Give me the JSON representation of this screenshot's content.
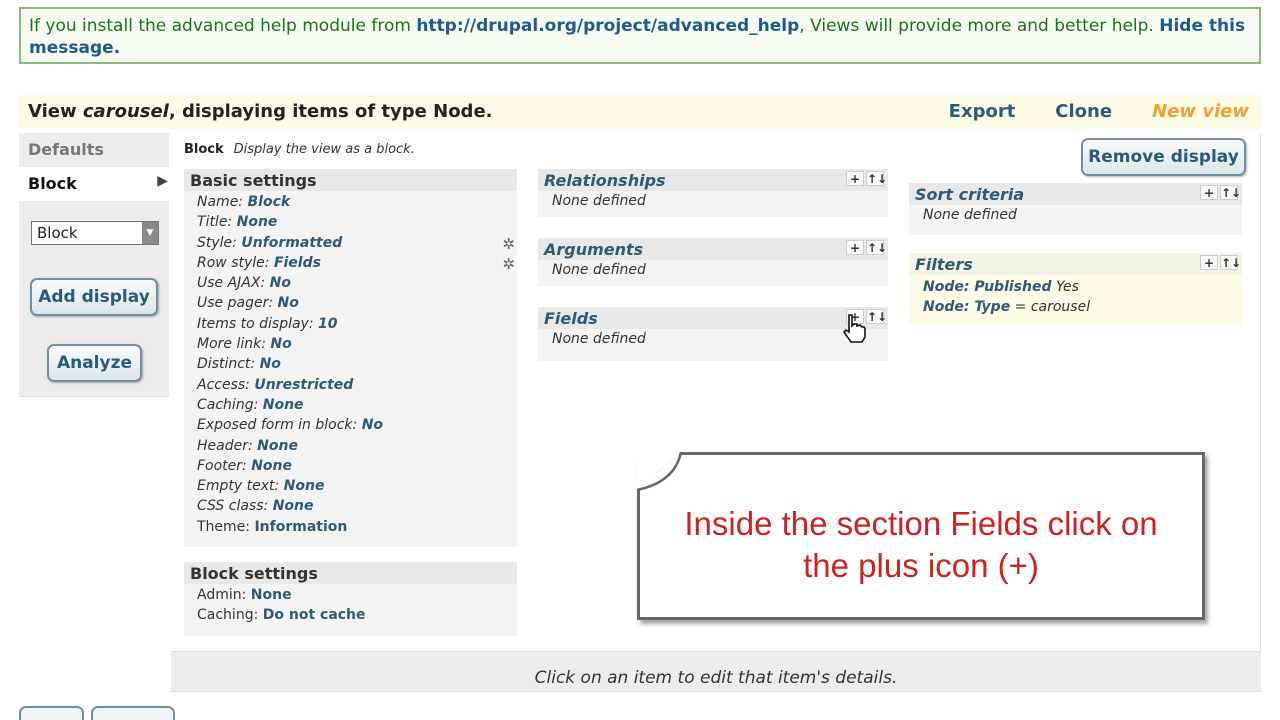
{
  "help_message": {
    "text_before": "If you install the advanced help module from ",
    "link": "http://drupal.org/project/advanced_help",
    "text_after": ", Views will provide more and better help. ",
    "hide": "Hide this message."
  },
  "view_header": {
    "prefix": "View ",
    "view_name": "carousel",
    "suffix": ", displaying items of type Node.",
    "links": [
      "Export",
      "Clone",
      "New view"
    ]
  },
  "tabs": {
    "defaults": "Defaults",
    "block": "Block",
    "select_value": "Block",
    "add_display": "Add display",
    "analyze": "Analyze"
  },
  "display": {
    "name": "Block",
    "description": "Display the view as a block.",
    "remove_label": "Remove display"
  },
  "basic_settings": {
    "title": "Basic settings",
    "rows": [
      {
        "label": "Name:",
        "value": "Block"
      },
      {
        "label": "Title:",
        "value": "None"
      },
      {
        "label": "Style:",
        "value": "Unformatted"
      },
      {
        "label": "Row style:",
        "value": "Fields"
      },
      {
        "label": "Use AJAX:",
        "value": "No"
      },
      {
        "label": "Use pager:",
        "value": "No"
      },
      {
        "label": "Items to display:",
        "value": "10"
      },
      {
        "label": "More link:",
        "value": "No"
      },
      {
        "label": "Distinct:",
        "value": "No"
      },
      {
        "label": "Access:",
        "value": "Unrestricted"
      },
      {
        "label": "Caching:",
        "value": "None"
      },
      {
        "label": "Exposed form in block:",
        "value": "No"
      },
      {
        "label": "Header:",
        "value": "None"
      },
      {
        "label": "Footer:",
        "value": "None"
      },
      {
        "label": "Empty text:",
        "value": "None"
      },
      {
        "label": "CSS class:",
        "value": "None"
      },
      {
        "label": "Theme:",
        "value": "Information"
      }
    ]
  },
  "block_settings": {
    "title": "Block settings",
    "rows": [
      {
        "label": "Admin:",
        "value": "None"
      },
      {
        "label": "Caching:",
        "value": "Do not cache"
      }
    ]
  },
  "relationships": {
    "title": "Relationships",
    "body": "None defined"
  },
  "arguments": {
    "title": "Arguments",
    "body": "None defined"
  },
  "fields": {
    "title": "Fields",
    "body": "None defined"
  },
  "sort_criteria": {
    "title": "Sort criteria",
    "body": "None defined"
  },
  "filters": {
    "title": "Filters",
    "rows": [
      {
        "label": "Node: Published",
        "value": "Yes"
      },
      {
        "label": "Node: Type",
        "value": "= carousel"
      }
    ]
  },
  "icons": {
    "add": "+",
    "rearrange": "↑↓",
    "gear": "✲"
  },
  "footer_text": "Click on an item to edit that item's details.",
  "callout": {
    "line1": "Inside the section Fields click on",
    "line2": "the plus icon (+)"
  }
}
